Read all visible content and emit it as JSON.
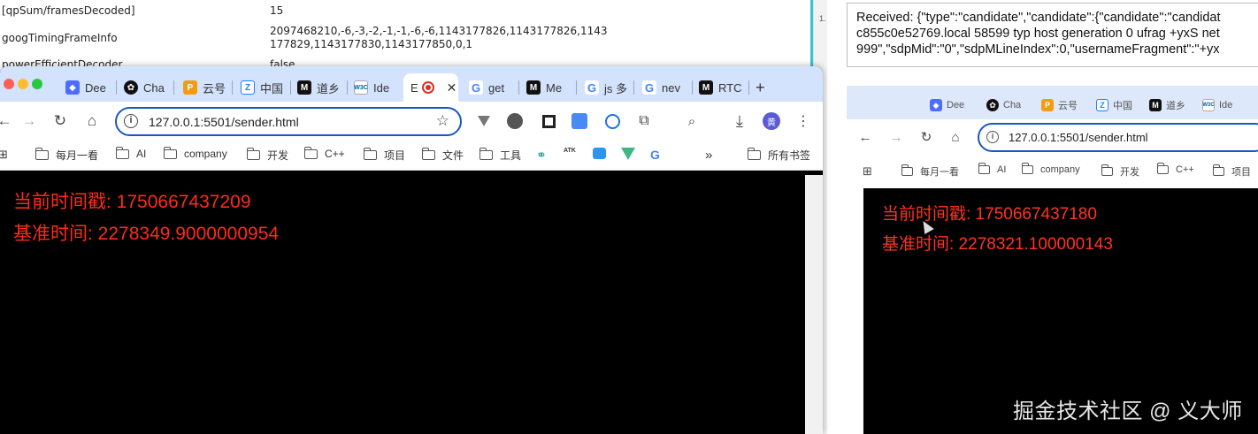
{
  "stats_page": {
    "rows": [
      {
        "key": "[qpSum/framesDecoded]",
        "value": "15"
      },
      {
        "key": "googTimingFrameInfo",
        "value_line1": "2097468210,-6,-3,-2,-1,-1,-6,-6,1143177826,1143177826,1143",
        "value_line2": "177829,1143177830,1143177850,0,1"
      },
      {
        "key": "powerEfficientDecoder",
        "value": "false"
      }
    ],
    "side_text": "1."
  },
  "left_window": {
    "tabs": [
      {
        "label": "Dee",
        "icon": "deepseek-icon",
        "color": "#4d6bfe"
      },
      {
        "label": "Cha",
        "icon": "chatgpt-icon",
        "color": "#111111"
      },
      {
        "label": "云号",
        "icon": "cloud-doc-icon",
        "color": "#f39c12"
      },
      {
        "label": "中国",
        "icon": "juejin-icon",
        "color": "#1e80ff"
      },
      {
        "label": "道乡",
        "icon": "m-icon",
        "color": "#111111"
      },
      {
        "label": "Ide",
        "icon": "w3c-icon",
        "color": "#ffffff"
      },
      {
        "label": "E",
        "icon": "record-icon",
        "color": "#d93025"
      },
      {
        "label": "get",
        "icon": "google-icon",
        "color": "#4285f4"
      },
      {
        "label": "Me",
        "icon": "m-icon",
        "color": "#111111"
      },
      {
        "label": "js 多",
        "icon": "google-icon",
        "color": "#4285f4"
      },
      {
        "label": "nev",
        "icon": "google-icon",
        "color": "#4285f4"
      },
      {
        "label": "RTC",
        "icon": "m-icon",
        "color": "#111111"
      }
    ],
    "new_tab": "+",
    "address": "127.0.0.1:5501/sender.html",
    "avatar_text": "黄",
    "bookmarks": [
      "每月一看",
      "AI",
      "company",
      "开发",
      "C++",
      "项目",
      "文件",
      "工具"
    ],
    "bookmark_icons": [
      "atk-icon",
      "blue-icon",
      "vue-icon",
      "google-icon"
    ],
    "bookmark_atk": "ATK",
    "more": "»",
    "all_bookmarks": "所有书签",
    "content": {
      "timestamp_line": "当前时间戳: 1750667437209",
      "base_line": "基准时间: 2278349.9000000954"
    }
  },
  "received_box": {
    "line1": "Received: {\"type\":\"candidate\",\"candidate\":{\"candidate\":\"candidat",
    "line2": "c855c0e52769.local 58599 typ host generation 0 ufrag +yxS net",
    "line3": "999\",\"sdpMid\":\"0\",\"sdpMLineIndex\":0,\"usernameFragment\":\"+yx"
  },
  "right_window": {
    "tabs": [
      {
        "label": "Dee",
        "color": "#4d6bfe"
      },
      {
        "label": "Cha",
        "color": "#111111"
      },
      {
        "label": "云号",
        "color": "#f39c12"
      },
      {
        "label": "中国",
        "color": "#1e80ff"
      },
      {
        "label": "道乡",
        "color": "#111111"
      },
      {
        "label": "Ide",
        "color": "#ffffff"
      }
    ],
    "address": "127.0.0.1:5501/sender.html",
    "bookmarks": [
      "每月一看",
      "AI",
      "company",
      "开发",
      "C++",
      "项目"
    ],
    "content": {
      "timestamp_line": "当前时间戳: 1750667437180",
      "base_line": "基准时间: 2278321.100000143"
    }
  },
  "watermark": "掘金技术社区 @ 义大师"
}
